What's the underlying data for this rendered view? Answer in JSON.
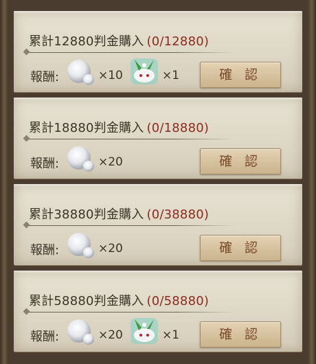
{
  "rewards_label": "報酬:",
  "confirm_label": "確 認",
  "items": [
    {
      "title": "累計12880判金購入",
      "progress": "(0/12880)",
      "qty1": "×10",
      "has_rabbit": true,
      "qty2": "×1"
    },
    {
      "title": "累計18880判金購入",
      "progress": "(0/18880)",
      "qty1": "×20",
      "has_rabbit": false,
      "qty2": ""
    },
    {
      "title": "累計38880判金購入",
      "progress": "(0/38880)",
      "qty1": "×20",
      "has_rabbit": false,
      "qty2": ""
    },
    {
      "title": "累計58880判金購入",
      "progress": "(0/58880)",
      "qty1": "×20",
      "has_rabbit": true,
      "qty2": "×1"
    }
  ],
  "colors": {
    "progress": "#8c2a20",
    "text": "#3b3328",
    "button_text": "#7a4a2a"
  },
  "icons": [
    "snowball-icon",
    "snow-rabbit-icon"
  ]
}
